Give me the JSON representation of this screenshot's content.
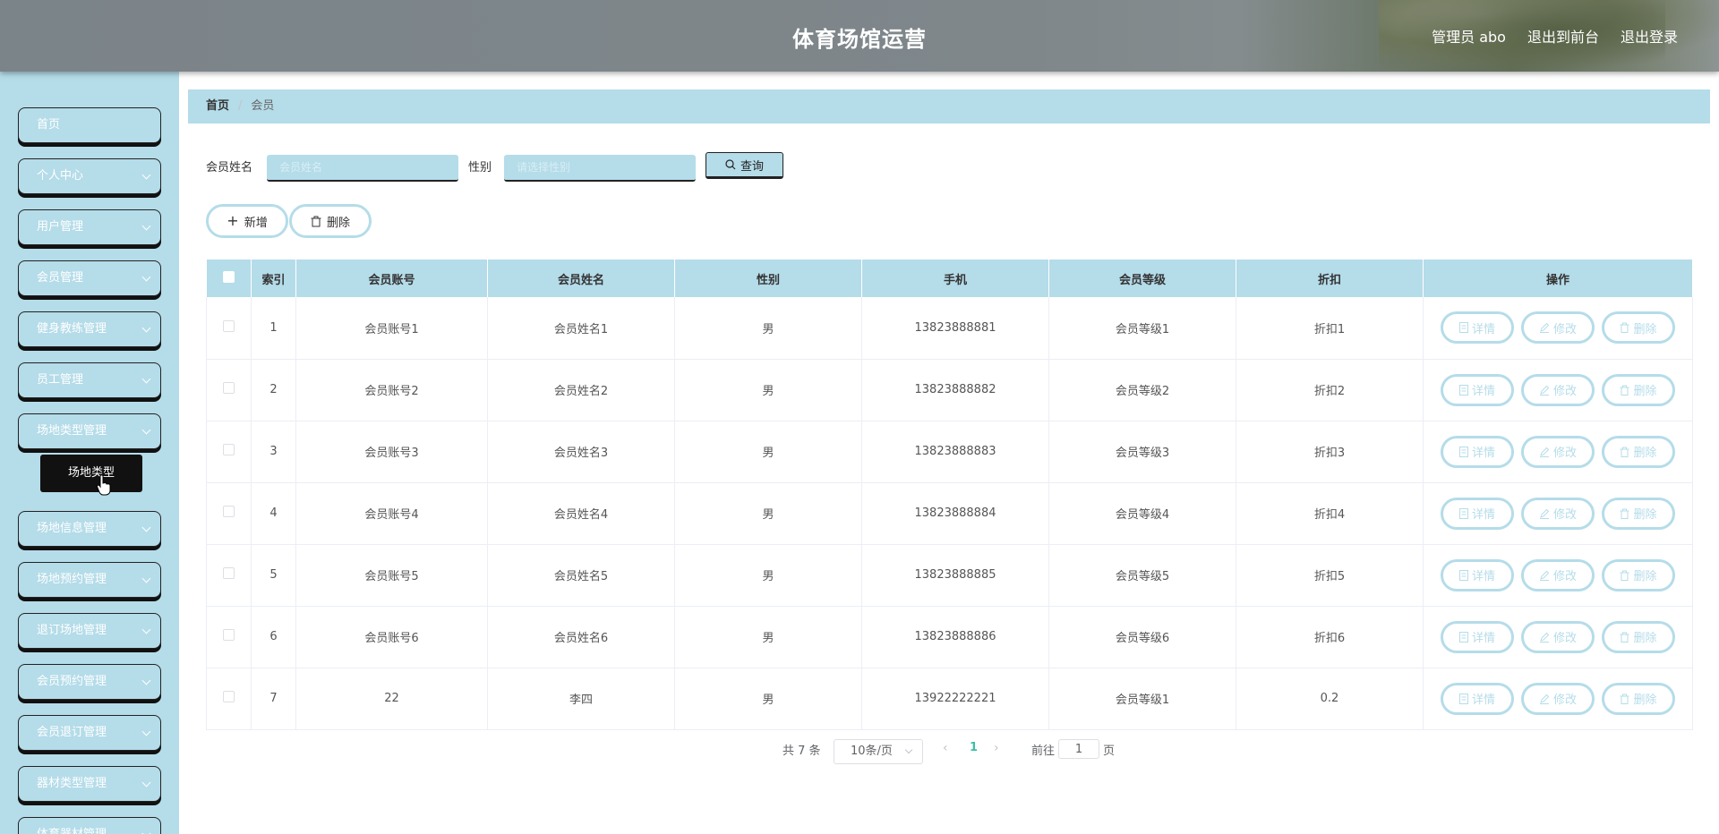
{
  "header": {
    "title": "体育场馆运营",
    "admin_label": "管理员 abo",
    "front_label": "退出到前台",
    "logout_label": "退出登录"
  },
  "sidebar": {
    "items": [
      {
        "label": "首页",
        "has_children": false
      },
      {
        "label": "个人中心",
        "has_children": true
      },
      {
        "label": "用户管理",
        "has_children": true
      },
      {
        "label": "会员管理",
        "has_children": true
      },
      {
        "label": "健身教练管理",
        "has_children": true
      },
      {
        "label": "员工管理",
        "has_children": true
      },
      {
        "label": "场地类型管理",
        "has_children": true
      },
      {
        "label": "场地信息管理",
        "has_children": true
      },
      {
        "label": "场地预约管理",
        "has_children": true
      },
      {
        "label": "退订场地管理",
        "has_children": true
      },
      {
        "label": "会员预约管理",
        "has_children": true
      },
      {
        "label": "会员退订管理",
        "has_children": true
      },
      {
        "label": "器材类型管理",
        "has_children": true
      },
      {
        "label": "体育器材管理",
        "has_children": true
      }
    ],
    "open_submenu": {
      "parent": "场地类型管理",
      "item": "场地类型"
    }
  },
  "breadcrumb": {
    "home": "首页",
    "current": "会员"
  },
  "search": {
    "name_label": "会员姓名",
    "name_placeholder": "会员姓名",
    "gender_label": "性别",
    "gender_placeholder": "请选择性别",
    "query_label": "查询"
  },
  "actions": {
    "add_label": "新增",
    "delete_label": "删除"
  },
  "table": {
    "columns": [
      "索引",
      "会员账号",
      "会员姓名",
      "性别",
      "手机",
      "会员等级",
      "折扣",
      "操作"
    ],
    "row_actions": {
      "detail": "详情",
      "edit": "修改",
      "delete": "删除"
    },
    "rows": [
      {
        "index": "1",
        "account": "会员账号1",
        "name": "会员姓名1",
        "gender": "男",
        "phone": "13823888881",
        "level": "会员等级1",
        "discount": "折扣1"
      },
      {
        "index": "2",
        "account": "会员账号2",
        "name": "会员姓名2",
        "gender": "男",
        "phone": "13823888882",
        "level": "会员等级2",
        "discount": "折扣2"
      },
      {
        "index": "3",
        "account": "会员账号3",
        "name": "会员姓名3",
        "gender": "男",
        "phone": "13823888883",
        "level": "会员等级3",
        "discount": "折扣3"
      },
      {
        "index": "4",
        "account": "会员账号4",
        "name": "会员姓名4",
        "gender": "男",
        "phone": "13823888884",
        "level": "会员等级4",
        "discount": "折扣4"
      },
      {
        "index": "5",
        "account": "会员账号5",
        "name": "会员姓名5",
        "gender": "男",
        "phone": "13823888885",
        "level": "会员等级5",
        "discount": "折扣5"
      },
      {
        "index": "6",
        "account": "会员账号6",
        "name": "会员姓名6",
        "gender": "男",
        "phone": "13823888886",
        "level": "会员等级6",
        "discount": "折扣6"
      },
      {
        "index": "7",
        "account": "22",
        "name": "李四",
        "gender": "男",
        "phone": "13922222221",
        "level": "会员等级1",
        "discount": "0.2"
      }
    ]
  },
  "pagination": {
    "total_text": "共 7 条",
    "page_size": "10条/页",
    "current_page": "1",
    "goto_prefix": "前往",
    "goto_value": "1",
    "goto_suffix": "页"
  },
  "colors": {
    "accent": "#b5dce9",
    "active_page": "#3ebfa5"
  }
}
